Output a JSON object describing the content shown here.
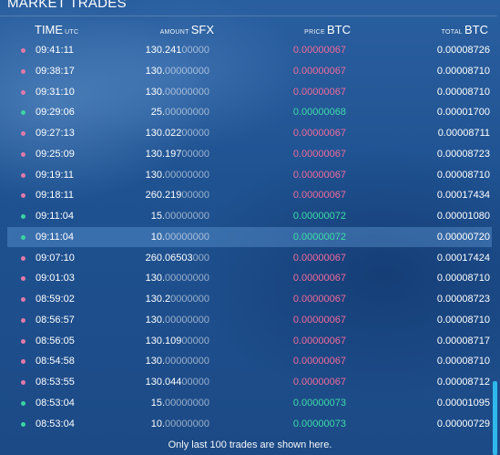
{
  "panel": {
    "title": "MARKET TRADES"
  },
  "columns": {
    "time": {
      "label": "TIME",
      "unit": "UTC"
    },
    "amount": {
      "label": "AMOUNT",
      "unit": "SFX"
    },
    "price": {
      "label": "PRICE",
      "unit": "BTC"
    },
    "total": {
      "label": "TOTAL",
      "unit": "BTC"
    }
  },
  "trades": [
    {
      "side": "sell",
      "time": "09:41:11",
      "amount_int": "130.",
      "amount_sig": "241",
      "amount_pad": "00000",
      "price_int": "0.",
      "price_frac": "00000067",
      "total": "0.00008726",
      "highlighted": false
    },
    {
      "side": "sell",
      "time": "09:38:17",
      "amount_int": "130.",
      "amount_sig": "",
      "amount_pad": "00000000",
      "price_int": "0.",
      "price_frac": "00000067",
      "total": "0.00008710",
      "highlighted": false
    },
    {
      "side": "sell",
      "time": "09:31:10",
      "amount_int": "130.",
      "amount_sig": "",
      "amount_pad": "00000000",
      "price_int": "0.",
      "price_frac": "00000067",
      "total": "0.00008710",
      "highlighted": false
    },
    {
      "side": "buy",
      "time": "09:29:06",
      "amount_int": "25.",
      "amount_sig": "",
      "amount_pad": "00000000",
      "price_int": "0.",
      "price_frac": "00000068",
      "total": "0.00001700",
      "highlighted": false
    },
    {
      "side": "sell",
      "time": "09:27:13",
      "amount_int": "130.",
      "amount_sig": "022",
      "amount_pad": "00000",
      "price_int": "0.",
      "price_frac": "00000067",
      "total": "0.00008711",
      "highlighted": false
    },
    {
      "side": "sell",
      "time": "09:25:09",
      "amount_int": "130.",
      "amount_sig": "197",
      "amount_pad": "00000",
      "price_int": "0.",
      "price_frac": "00000067",
      "total": "0.00008723",
      "highlighted": false
    },
    {
      "side": "sell",
      "time": "09:19:11",
      "amount_int": "130.",
      "amount_sig": "",
      "amount_pad": "00000000",
      "price_int": "0.",
      "price_frac": "00000067",
      "total": "0.00008710",
      "highlighted": false
    },
    {
      "side": "sell",
      "time": "09:18:11",
      "amount_int": "260.",
      "amount_sig": "219",
      "amount_pad": "00000",
      "price_int": "0.",
      "price_frac": "00000067",
      "total": "0.00017434",
      "highlighted": false
    },
    {
      "side": "buy",
      "time": "09:11:04",
      "amount_int": "15.",
      "amount_sig": "",
      "amount_pad": "00000000",
      "price_int": "0.",
      "price_frac": "00000072",
      "total": "0.00001080",
      "highlighted": false
    },
    {
      "side": "buy",
      "time": "09:11:04",
      "amount_int": "10.",
      "amount_sig": "",
      "amount_pad": "00000000",
      "price_int": "0.",
      "price_frac": "00000072",
      "total": "0.00000720",
      "highlighted": true
    },
    {
      "side": "sell",
      "time": "09:07:10",
      "amount_int": "260.",
      "amount_sig": "06503",
      "amount_pad": "000",
      "price_int": "0.",
      "price_frac": "00000067",
      "total": "0.00017424",
      "highlighted": false
    },
    {
      "side": "sell",
      "time": "09:01:03",
      "amount_int": "130.",
      "amount_sig": "",
      "amount_pad": "00000000",
      "price_int": "0.",
      "price_frac": "00000067",
      "total": "0.00008710",
      "highlighted": false
    },
    {
      "side": "sell",
      "time": "08:59:02",
      "amount_int": "130.",
      "amount_sig": "2",
      "amount_pad": "0000000",
      "price_int": "0.",
      "price_frac": "00000067",
      "total": "0.00008723",
      "highlighted": false
    },
    {
      "side": "sell",
      "time": "08:56:57",
      "amount_int": "130.",
      "amount_sig": "",
      "amount_pad": "00000000",
      "price_int": "0.",
      "price_frac": "00000067",
      "total": "0.00008710",
      "highlighted": false
    },
    {
      "side": "sell",
      "time": "08:56:05",
      "amount_int": "130.",
      "amount_sig": "109",
      "amount_pad": "00000",
      "price_int": "0.",
      "price_frac": "00000067",
      "total": "0.00008717",
      "highlighted": false
    },
    {
      "side": "sell",
      "time": "08:54:58",
      "amount_int": "130.",
      "amount_sig": "",
      "amount_pad": "00000000",
      "price_int": "0.",
      "price_frac": "00000067",
      "total": "0.00008710",
      "highlighted": false
    },
    {
      "side": "sell",
      "time": "08:53:55",
      "amount_int": "130.",
      "amount_sig": "044",
      "amount_pad": "00000",
      "price_int": "0.",
      "price_frac": "00000067",
      "total": "0.00008712",
      "highlighted": false
    },
    {
      "side": "buy",
      "time": "08:53:04",
      "amount_int": "15.",
      "amount_sig": "",
      "amount_pad": "00000000",
      "price_int": "0.",
      "price_frac": "00000073",
      "total": "0.00001095",
      "highlighted": false
    },
    {
      "side": "buy",
      "time": "08:53:04",
      "amount_int": "10.",
      "amount_sig": "",
      "amount_pad": "00000000",
      "price_int": "0.",
      "price_frac": "00000073",
      "total": "0.00000729",
      "highlighted": false
    }
  ],
  "footer": {
    "text": "Only last 100 trades are shown here."
  },
  "colors": {
    "sell": "#f06a9a",
    "buy": "#3fdca8",
    "highlight": "#6eaae6",
    "scrollbar": "#2eb8ec"
  }
}
